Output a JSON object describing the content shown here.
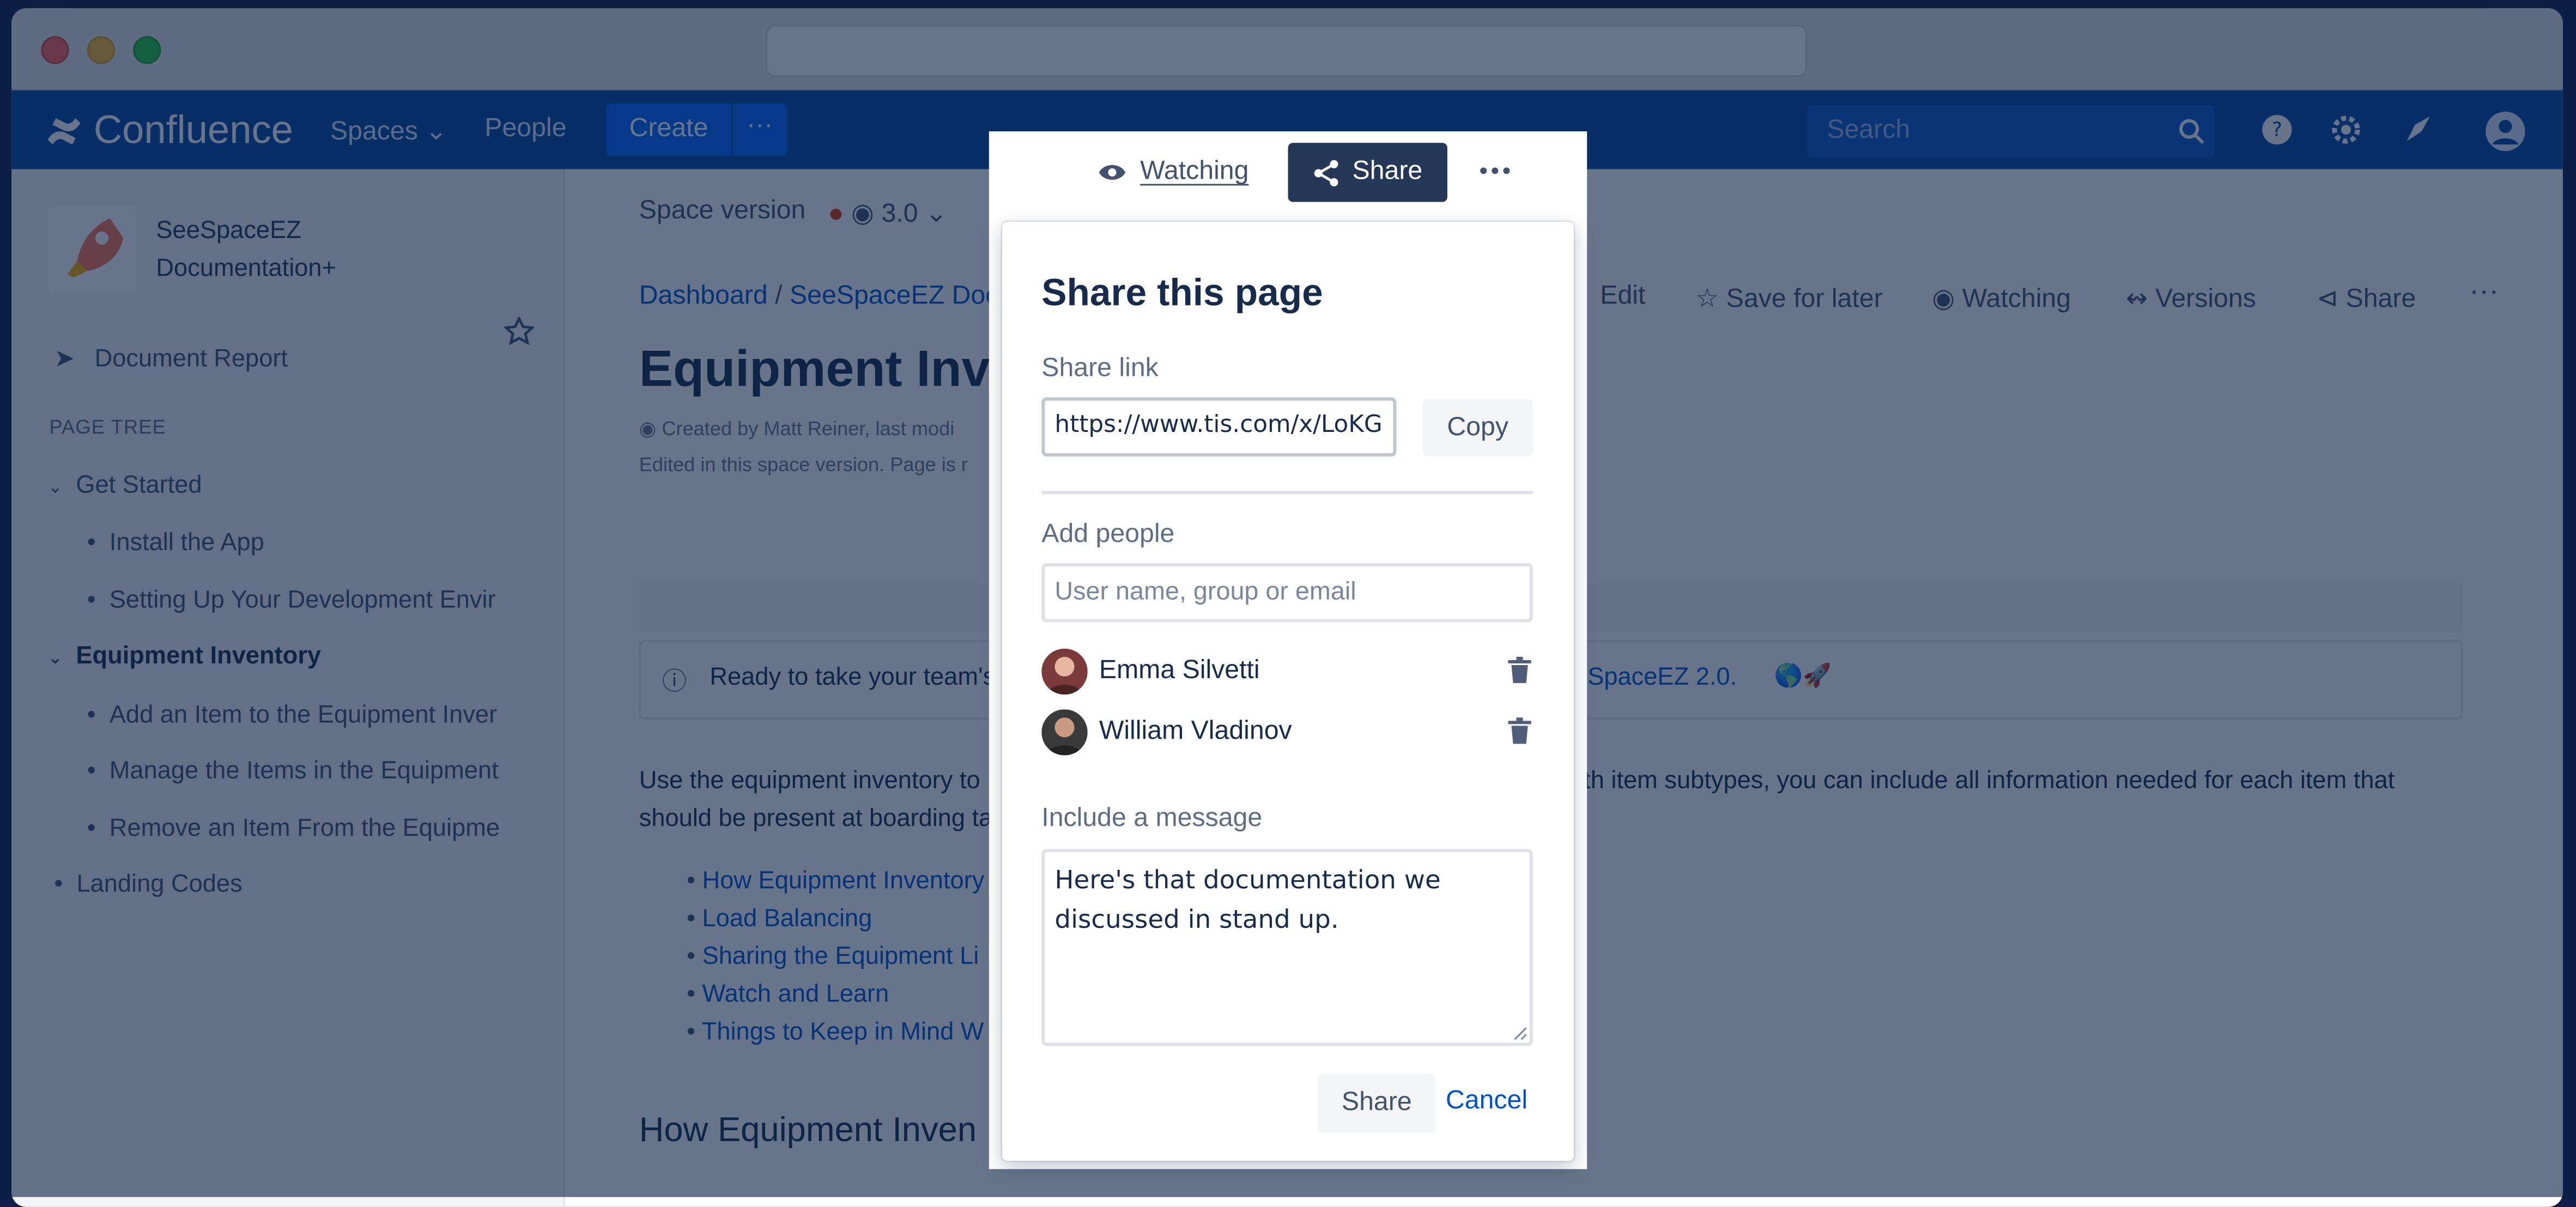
{
  "nav": {
    "logo": "Confluence",
    "spaces": "Spaces",
    "people": "People",
    "create": "Create",
    "more": "···",
    "search_placeholder": "Search"
  },
  "sidebar": {
    "space_title_line1": "SeeSpaceEZ",
    "space_title_line2": "Documentation+",
    "document_report": "Document Report",
    "page_tree_heading": "PAGE TREE",
    "items": [
      {
        "label": "Get Started"
      },
      {
        "label": "Install the App"
      },
      {
        "label": "Setting Up Your Development Envir"
      },
      {
        "label": "Equipment Inventory"
      },
      {
        "label": "Add an Item to the Equipment Inver"
      },
      {
        "label": "Manage the Items in the Equipment"
      },
      {
        "label": "Remove an Item From the Equipme"
      },
      {
        "label": "Landing Codes"
      }
    ]
  },
  "page": {
    "space_version_label": "Space version",
    "space_version_value": "3.0",
    "breadcrumb_1": "Dashboard",
    "breadcrumb_sep": "/",
    "breadcrumb_2": "SeeSpaceEZ Docu",
    "actions": {
      "edit": "Edit",
      "save_for_later": "Save for later",
      "watching": "Watching",
      "versions": "Versions",
      "share": "Share"
    },
    "title": "Equipment Inver",
    "meta_line1": "Created by Matt Reiner, last modi",
    "meta_line2": "Edited in this space version. Page is r",
    "banner_text": "Ready to take your team's",
    "banner_link": "eSpaceEZ 2.0.",
    "body_line1_start": "Use the equipment inventory to",
    "body_line1_end": "th item subtypes, you can include all information needed for each item that",
    "body_line2": "should be present at boarding ta",
    "toc": [
      "How Equipment Inventory",
      "Load Balancing",
      "Sharing the Equipment Li",
      "Watch and Learn",
      "Things to Keep in Mind W"
    ],
    "section_heading": "How Equipment Inven"
  },
  "share_popup": {
    "watching_label": "Watching",
    "share_label": "Share",
    "more_label": "···",
    "title": "Share this page",
    "share_link_label": "Share link",
    "share_link_value": "https://www.tis.com/x/LoKG",
    "copy_label": "Copy",
    "add_people_label": "Add people",
    "add_people_placeholder": "User name, group or email",
    "people": [
      {
        "name": "Emma Silvetti"
      },
      {
        "name": "William Vladinov"
      }
    ],
    "message_label": "Include a message",
    "message_value": "Here's that documentation we discussed in stand up.",
    "share_button": "Share",
    "cancel_button": "Cancel"
  }
}
